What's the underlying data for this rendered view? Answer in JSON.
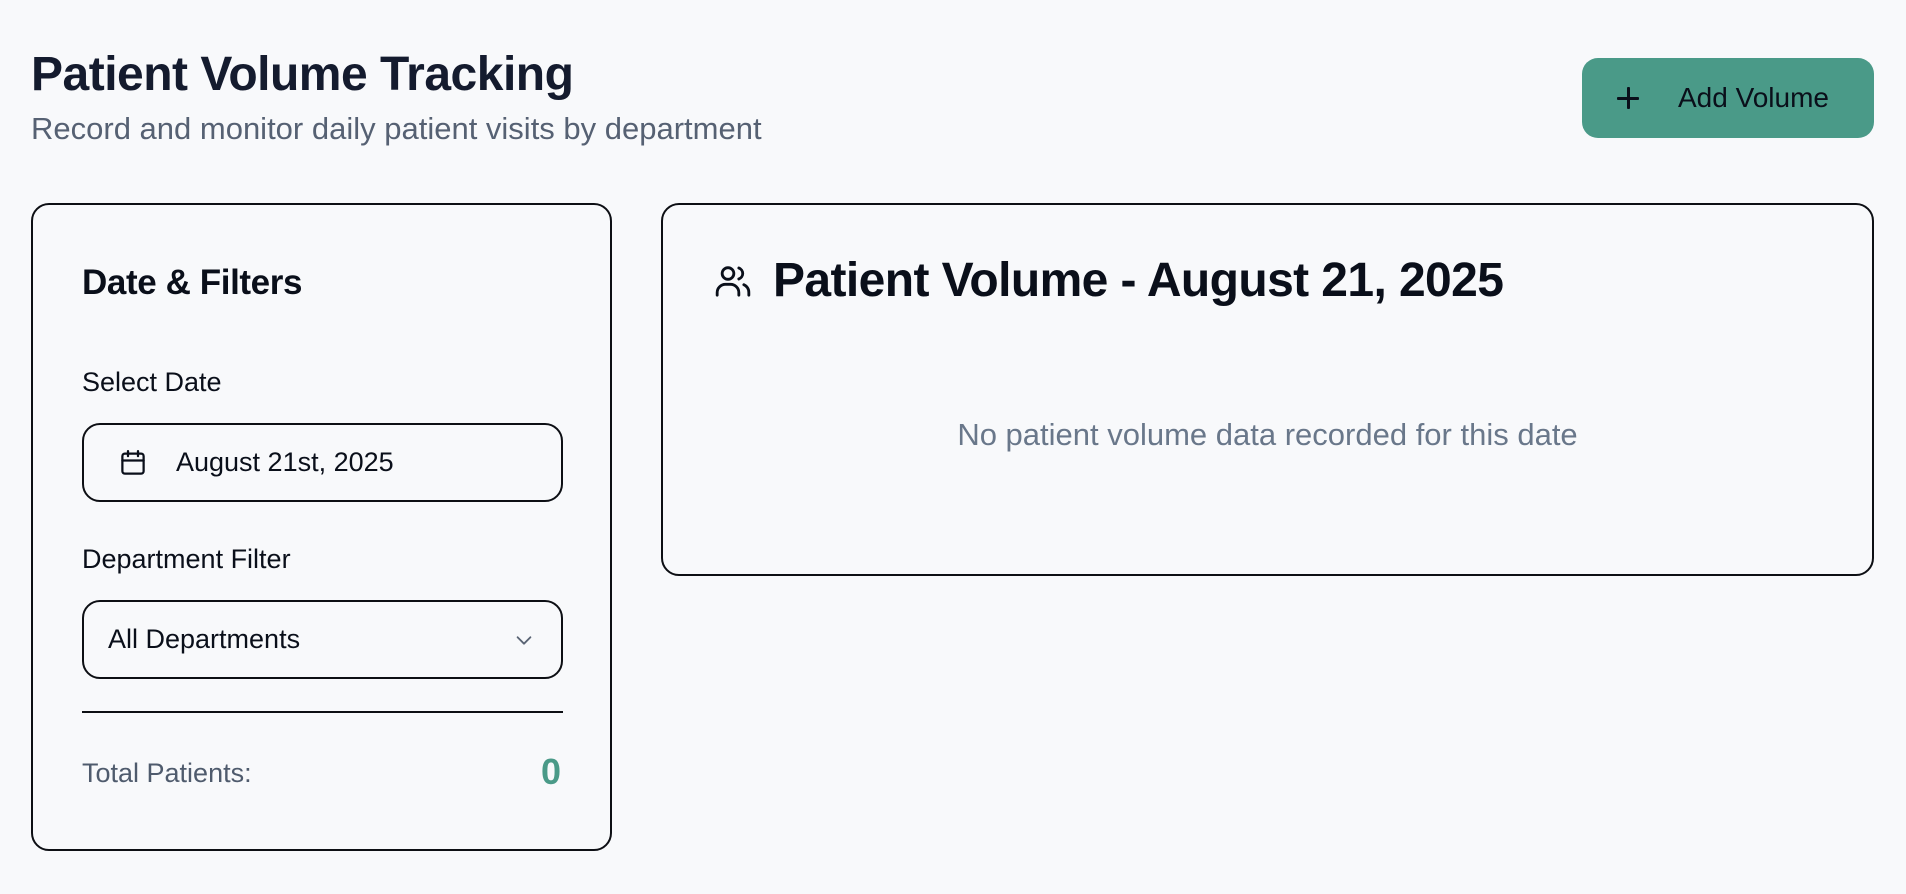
{
  "header": {
    "title": "Patient Volume Tracking",
    "subtitle": "Record and monitor daily patient visits by department",
    "add_button_label": "Add Volume",
    "add_button_icon": "plus-icon"
  },
  "filters": {
    "title": "Date & Filters",
    "date_label": "Select Date",
    "date_value": "August 21st, 2025",
    "date_icon": "calendar-icon",
    "department_label": "Department Filter",
    "department_value": "All Departments",
    "department_icon": "chevron-down-icon",
    "total_label": "Total Patients:",
    "total_value": "0"
  },
  "volume": {
    "icon": "users-icon",
    "title": "Patient Volume - August 21, 2025",
    "empty_message": "No patient volume data recorded for this date"
  },
  "colors": {
    "accent": "#4a9a88",
    "background": "#f8f9fb",
    "title_text": "#141b2e",
    "muted_text": "#566173",
    "border": "#0d0f14"
  }
}
